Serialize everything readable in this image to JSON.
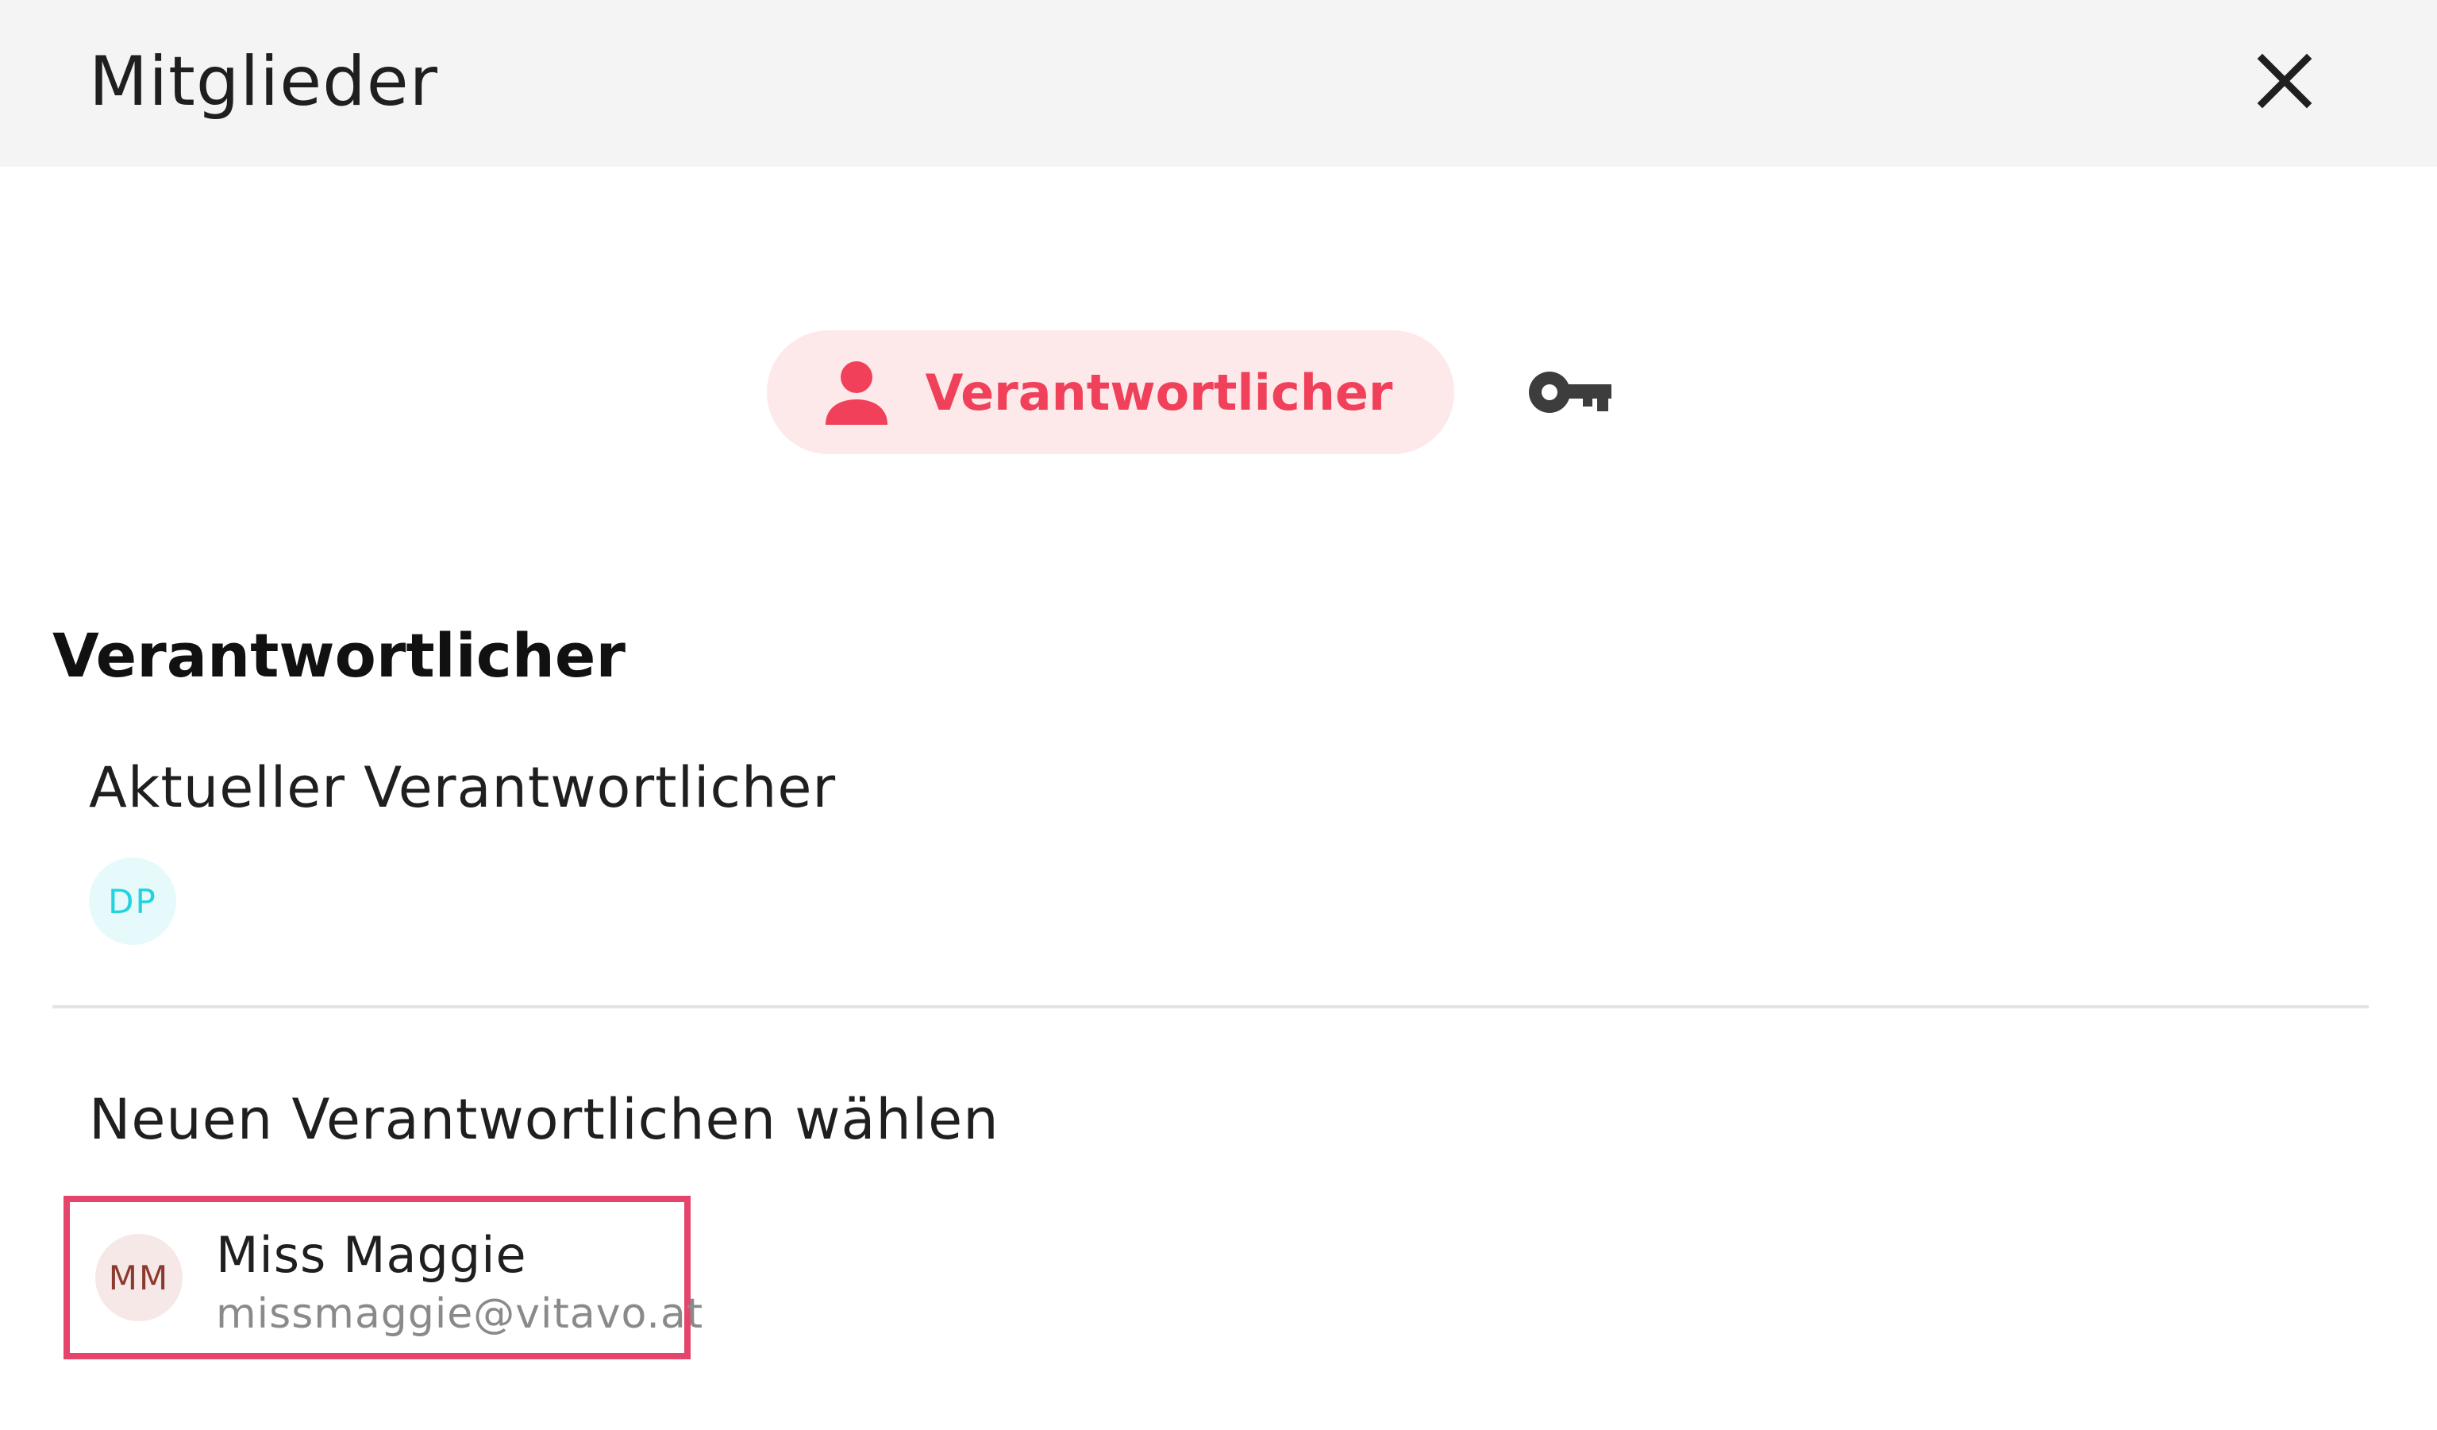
{
  "header": {
    "title": "Mitglieder",
    "close_icon": "close-icon"
  },
  "tabs": [
    {
      "label": "Verantwortlicher",
      "icon": "person-icon",
      "active": true
    },
    {
      "label": "",
      "icon": "key-icon",
      "active": false
    }
  ],
  "section": {
    "heading": "Verantwortlicher",
    "current_label": "Aktueller Verantwortlicher",
    "current_avatar_initials": "DP",
    "choose_label": "Neuen Verantwortlichen wählen"
  },
  "candidates": [
    {
      "initials": "MM",
      "name": "Miss Maggie",
      "email": "missmaggie@vitavo.at"
    }
  ],
  "colors": {
    "accent": "#f0405a",
    "accent_bg": "#fde8ea",
    "highlight_border": "#e5446b",
    "header_bg": "#f4f4f4",
    "dp_avatar_bg": "#e6fafb",
    "dp_avatar_text": "#22d3de",
    "mm_avatar_bg": "#f6e8e6",
    "mm_avatar_text": "#8b3a2e"
  }
}
